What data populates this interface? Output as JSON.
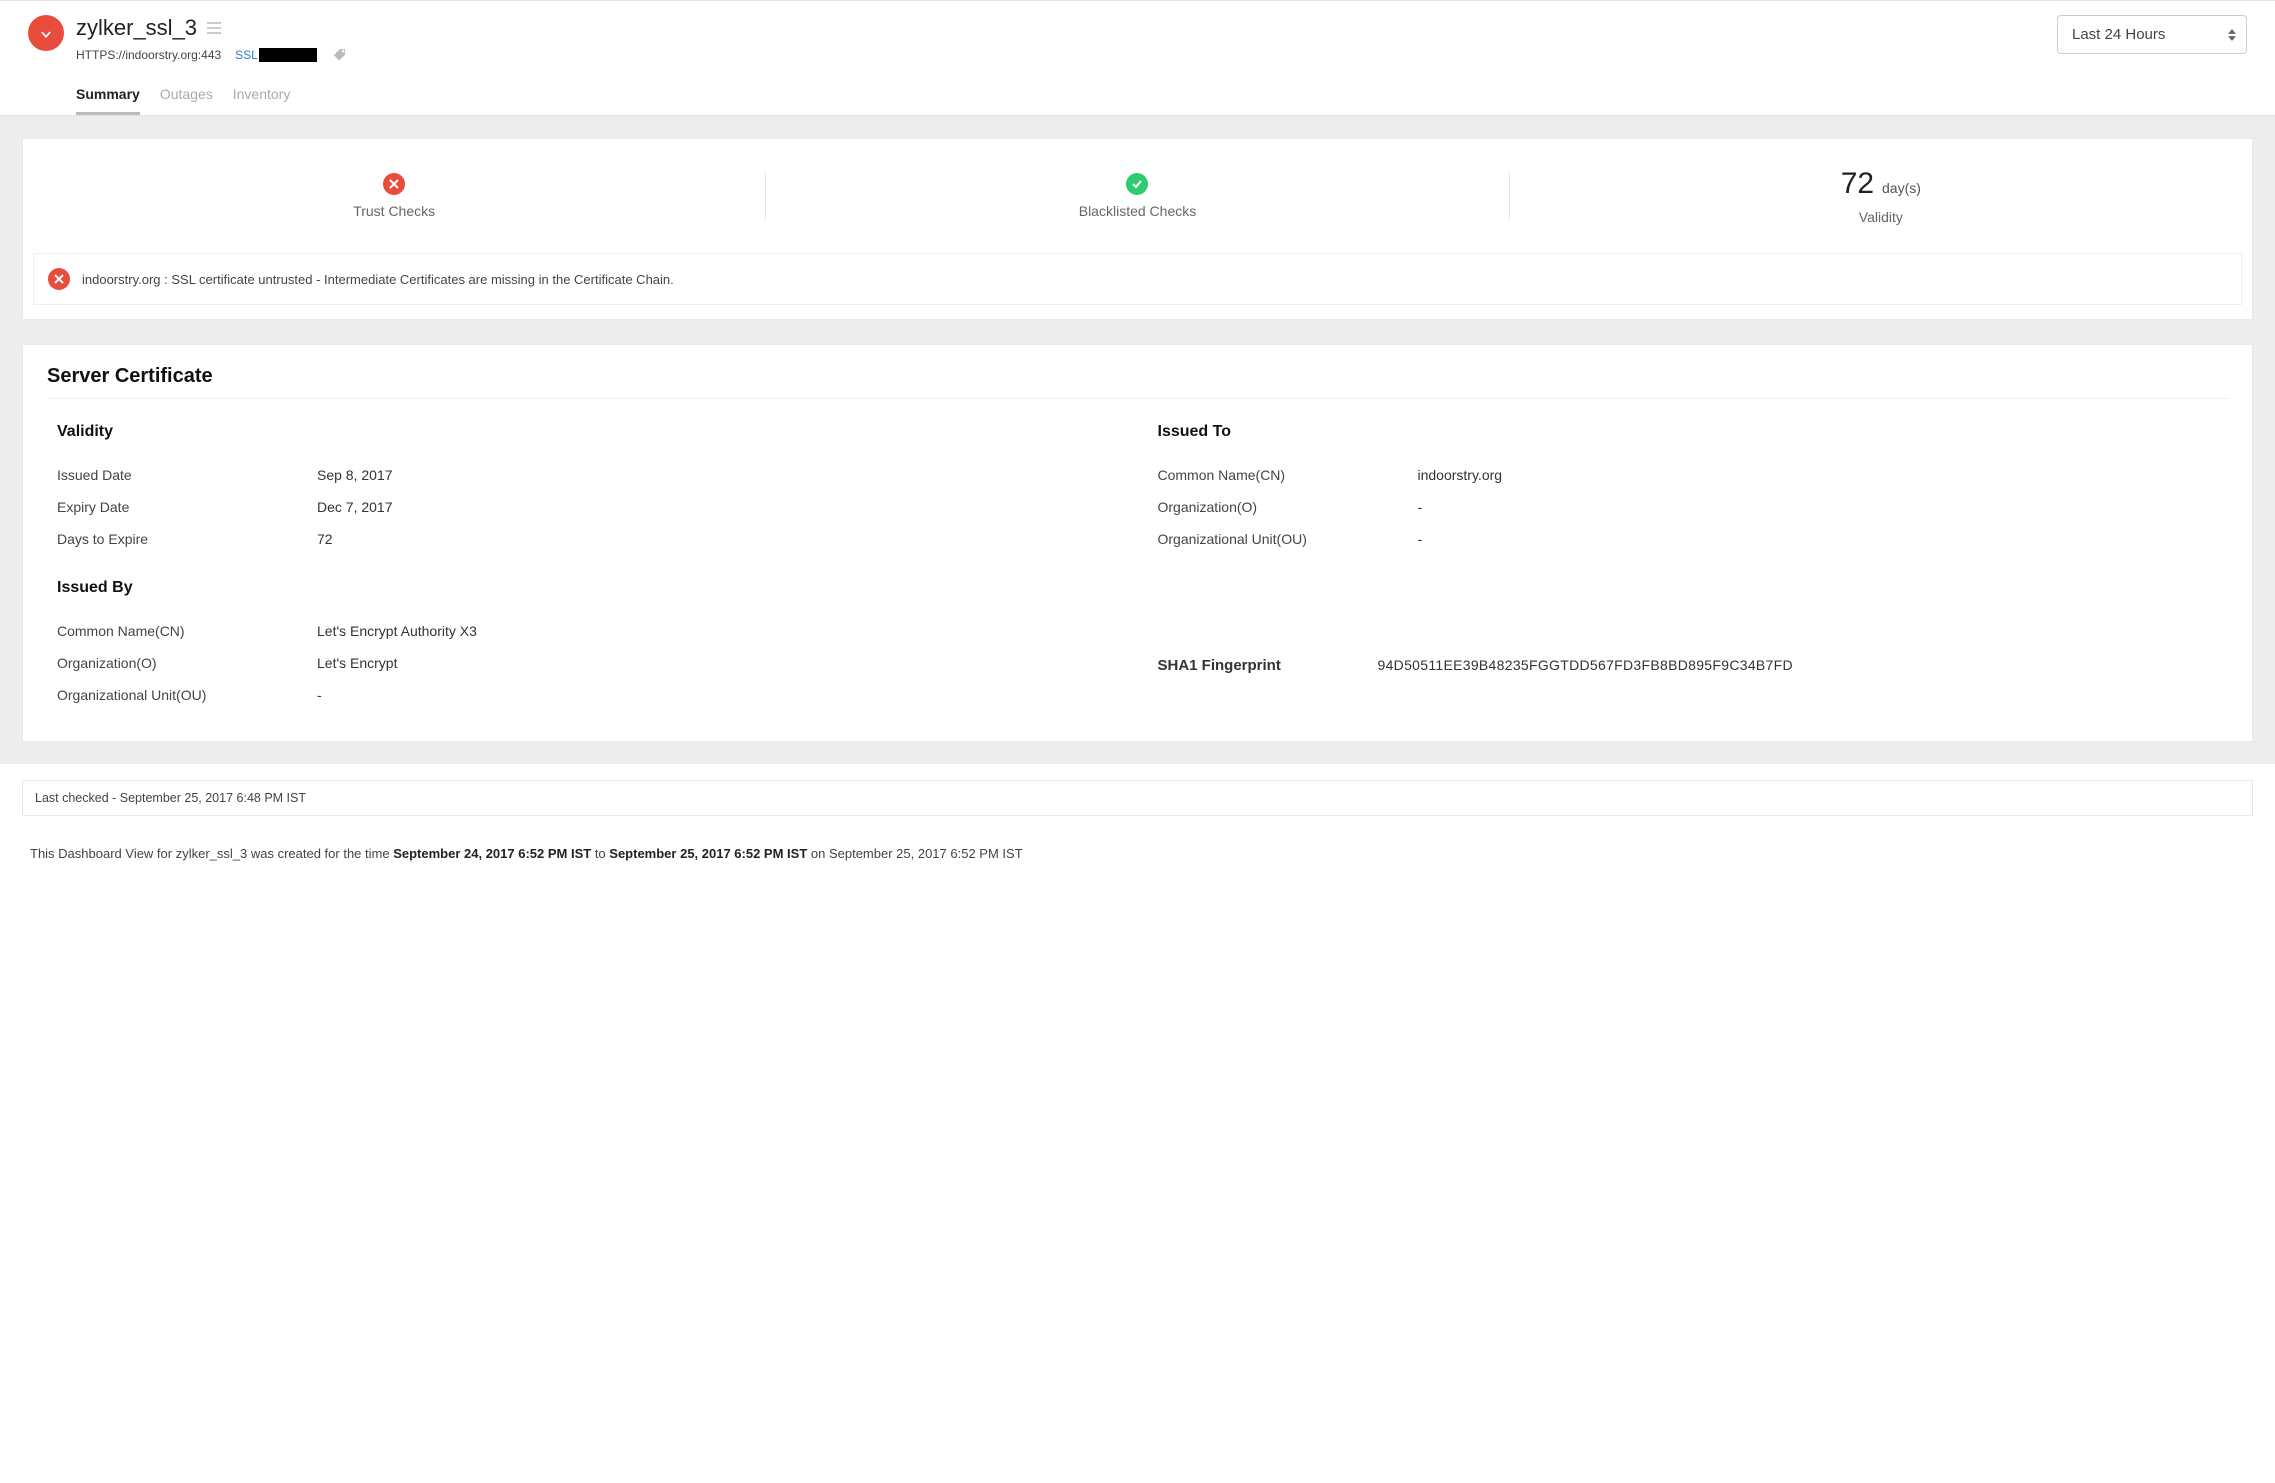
{
  "header": {
    "title": "zylker_ssl_3",
    "url": "HTTPS://indoorstry.org:443",
    "ssl_link": "SSL Certificate",
    "time_range": "Last 24 Hours"
  },
  "tabs": [
    {
      "label": "Summary",
      "active": true
    },
    {
      "label": "Outages",
      "active": false
    },
    {
      "label": "Inventory",
      "active": false
    }
  ],
  "checks": {
    "trust_label": "Trust Checks",
    "blacklist_label": "Blacklisted Checks",
    "validity_value": "72",
    "validity_unit": "day(s)",
    "validity_label": "Validity"
  },
  "alert": "indoorstry.org : SSL certificate untrusted - Intermediate Certificates are missing in the Certificate Chain.",
  "cert": {
    "title": "Server Certificate",
    "validity": {
      "heading": "Validity",
      "issued_date_k": "Issued Date",
      "issued_date_v": "Sep 8, 2017",
      "expiry_date_k": "Expiry Date",
      "expiry_date_v": "Dec 7, 2017",
      "days_expire_k": "Days to Expire",
      "days_expire_v": "72"
    },
    "issued_to": {
      "heading": "Issued To",
      "cn_k": "Common Name(CN)",
      "cn_v": "indoorstry.org",
      "org_k": "Organization(O)",
      "org_v": "-",
      "ou_k": "Organizational Unit(OU)",
      "ou_v": "-"
    },
    "issued_by": {
      "heading": "Issued By",
      "cn_k": "Common Name(CN)",
      "cn_v": "Let's Encrypt Authority X3",
      "org_k": "Organization(O)",
      "org_v": "Let's Encrypt",
      "ou_k": "Organizational Unit(OU)",
      "ou_v": "-"
    },
    "sha_k": "SHA1 Fingerprint",
    "sha_v": "94D50511EE39B48235FGGTDD567FD3FB8BD895F9C34B7FD"
  },
  "last_checked": "Last checked - September 25, 2017 6:48 PM IST",
  "footer": {
    "prefix": "This Dashboard View for zylker_ssl_3  was created for the time ",
    "from": "September 24, 2017 6:52 PM IST",
    "to_word": " to ",
    "to": "September 25, 2017 6:52 PM IST",
    "suffix": " on September 25, 2017 6:52 PM IST"
  }
}
